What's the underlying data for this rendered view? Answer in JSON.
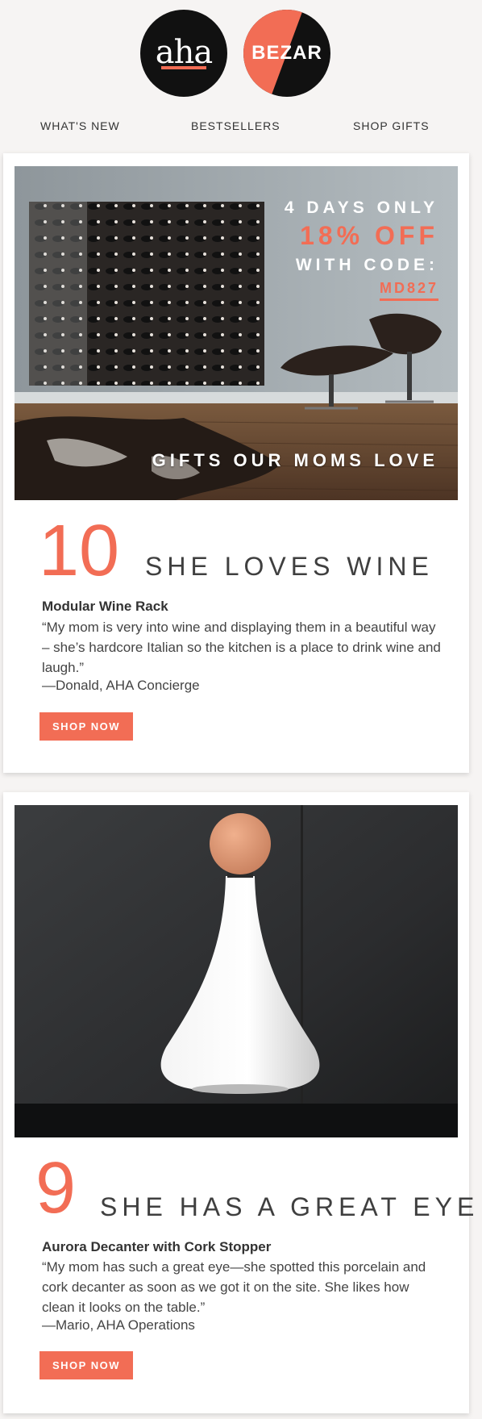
{
  "logos": {
    "aha": "aha",
    "bezar": "BEZAR"
  },
  "nav": [
    {
      "label": "WHAT'S NEW"
    },
    {
      "label": "BESTSELLERS"
    },
    {
      "label": "SHOP GIFTS"
    }
  ],
  "promo": {
    "line1": "4 DAYS ONLY",
    "line2": "18% OFF",
    "line3": "WITH CODE:",
    "code": "MD827",
    "tagline": "GIFTS OUR MOMS LOVE"
  },
  "items": [
    {
      "rank": "10",
      "headline": "SHE LOVES WINE",
      "product": "Modular Wine Rack",
      "quote": "“My mom is very into wine and displaying them in a beautiful way – she’s hardcore Italian so the kitchen is a place to drink wine and laugh.”",
      "attribution": "—Donald, AHA Concierge",
      "button": "SHOP NOW"
    },
    {
      "rank": "9",
      "headline": "SHE HAS A GREAT EYE",
      "product": "Aurora Decanter with Cork Stopper",
      "quote": "“My mom has such a great eye—she spotted this porcelain and cork decanter as soon as we got it on the site. She likes how clean it looks on the table.”",
      "attribution": "—Mario, AHA Operations",
      "button": "SHOP NOW"
    }
  ],
  "colors": {
    "accent": "#f26d55",
    "background": "#f6f4f3",
    "logo_dark": "#111111"
  }
}
